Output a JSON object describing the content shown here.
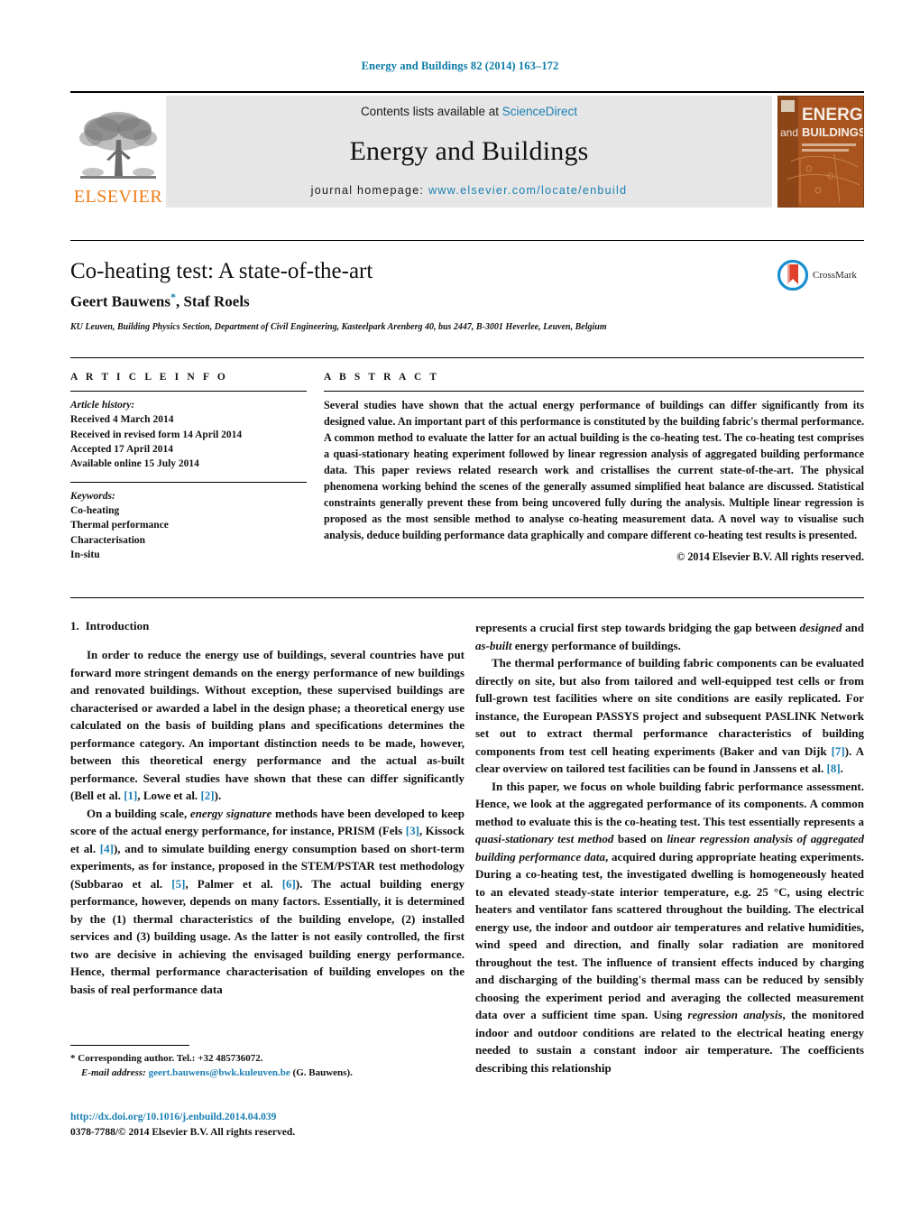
{
  "running_head": "Energy and Buildings 82 (2014) 163–172",
  "masthead": {
    "publisher_name": "ELSEVIER",
    "contents_prefix": "Contents lists available at ",
    "contents_link": "ScienceDirect",
    "journal_title": "Energy and Buildings",
    "homepage_prefix": "journal homepage: ",
    "homepage_url": "www.elsevier.com/locate/enbuild",
    "cover_title_line1": "ENERGY",
    "cover_title_and": "and",
    "cover_title_line2": "BUILDINGS"
  },
  "article": {
    "title": "Co-heating test: A state-of-the-art",
    "authors": "Geert Bauwens",
    "corresponding_marker": "*",
    "authors_rest": ", Staf Roels",
    "affiliation": "KU Leuven, Building Physics Section, Department of Civil Engineering, Kasteelpark Arenberg 40, bus 2447, B-3001 Heverlee, Leuven, Belgium",
    "crossmark_label": "CrossMark"
  },
  "info": {
    "heading": "A R T I C L E    I N F O",
    "history_label": "Article history:",
    "history": [
      "Received 4 March 2014",
      "Received in revised form 14 April 2014",
      "Accepted 17 April 2014",
      "Available online 15 July 2014"
    ],
    "keywords_label": "Keywords:",
    "keywords": [
      "Co-heating",
      "Thermal performance",
      "Characterisation",
      "In-situ"
    ]
  },
  "abstract": {
    "heading": "A B S T R A C T",
    "text": "Several studies have shown that the actual energy performance of buildings can differ significantly from its designed value. An important part of this performance is constituted by the building fabric's thermal performance. A common method to evaluate the latter for an actual building is the co-heating test. The co-heating test comprises a quasi-stationary heating experiment followed by linear regression analysis of aggregated building performance data. This paper reviews related research work and cristallises the current state-of-the-art. The physical phenomena working behind the scenes of the generally assumed simplified heat balance are discussed. Statistical constraints generally prevent these from being uncovered fully during the analysis. Multiple linear regression is proposed as the most sensible method to analyse co-heating measurement data. A novel way to visualise such analysis, deduce building performance data graphically and compare different co-heating test results is presented.",
    "copyright": "© 2014 Elsevier B.V. All rights reserved."
  },
  "introduction": {
    "number": "1.",
    "heading": "Introduction",
    "left_paragraphs": [
      {
        "parts": [
          {
            "t": "In order to reduce the energy use of buildings, several countries have put forward more stringent demands on the energy performance of new buildings and renovated buildings. Without exception, these supervised buildings are characterised or awarded a label in the design phase; a theoretical energy use calculated on the basis of building plans and specifications determines the performance category. An important distinction needs to be made, however, between this theoretical energy performance and the actual as-built performance. Several studies have shown that these can differ significantly (Bell et al. "
          },
          {
            "t": "[1]",
            "s": "cite"
          },
          {
            "t": ", Lowe et al. "
          },
          {
            "t": "[2]",
            "s": "cite"
          },
          {
            "t": ")."
          }
        ]
      },
      {
        "parts": [
          {
            "t": "On a building scale, "
          },
          {
            "t": "energy signature",
            "s": "it"
          },
          {
            "t": " methods have been developed to keep score of the actual energy performance, for instance, PRISM (Fels "
          },
          {
            "t": "[3]",
            "s": "cite"
          },
          {
            "t": ", Kissock et al. "
          },
          {
            "t": "[4]",
            "s": "cite"
          },
          {
            "t": "), and to simulate building energy consumption based on short-term experiments, as for instance, proposed in the STEM/PSTAR test methodology (Subbarao et al. "
          },
          {
            "t": "[5]",
            "s": "cite"
          },
          {
            "t": ", Palmer et al. "
          },
          {
            "t": "[6]",
            "s": "cite"
          },
          {
            "t": "). The actual building energy performance, however, depends on many factors. Essentially, it is determined by the (1) thermal characteristics of the building envelope, (2) installed services and (3) building usage. As the latter is not easily controlled, the first two are decisive in achieving the envisaged building energy performance. Hence, thermal performance characterisation of building envelopes on the basis of real performance data"
          }
        ]
      }
    ],
    "right_paragraphs": [
      {
        "continued": true,
        "parts": [
          {
            "t": "represents a crucial first step towards bridging the gap between "
          },
          {
            "t": "designed",
            "s": "it"
          },
          {
            "t": " and "
          },
          {
            "t": "as-built",
            "s": "it"
          },
          {
            "t": " energy performance of buildings."
          }
        ]
      },
      {
        "parts": [
          {
            "t": "The thermal performance of building fabric components can be evaluated directly on site, but also from tailored and well-equipped test cells or from full-grown test facilities where on site conditions are easily replicated. For instance, the European PASSYS project and subsequent PASLINK Network set out to extract thermal performance characteristics of building components from test cell heating experiments (Baker and van Dijk "
          },
          {
            "t": "[7]",
            "s": "cite"
          },
          {
            "t": "). A clear overview on tailored test facilities can be found in Janssens et al. "
          },
          {
            "t": "[8]",
            "s": "cite"
          },
          {
            "t": "."
          }
        ]
      },
      {
        "parts": [
          {
            "t": "In this paper, we focus on whole building fabric performance assessment. Hence, we look at the aggregated performance of its components. A common method to evaluate this is the co-heating test. This test essentially represents a "
          },
          {
            "t": "quasi-stationary test method",
            "s": "it"
          },
          {
            "t": " based on "
          },
          {
            "t": "linear regression analysis of aggregated building performance data",
            "s": "it"
          },
          {
            "t": ", acquired during appropriate heating experiments. During a co-heating test, the investigated dwelling is homogeneously heated to an elevated steady-state interior temperature, e.g. 25 °C, using electric heaters and ventilator fans scattered throughout the building. The electrical energy use, the indoor and outdoor air temperatures and relative humidities, wind speed and direction, and finally solar radiation are monitored throughout the test. The influence of transient effects induced by charging and discharging of the building's thermal mass can be reduced by sensibly choosing the experiment period and averaging the collected measurement data over a sufficient time span. Using "
          },
          {
            "t": "regression analysis",
            "s": "it"
          },
          {
            "t": ", the monitored indoor and outdoor conditions are related to the electrical heating energy needed to sustain a constant indoor air temperature. The coefficients describing this relationship"
          }
        ]
      }
    ]
  },
  "footer": {
    "corresponding_marker": "*",
    "corresponding_text": "Corresponding author. Tel.: +32 485736072.",
    "email_label": "E-mail address:",
    "email": "geert.bauwens@bwk.kuleuven.be",
    "email_suffix": "(G. Bauwens).",
    "doi": "http://dx.doi.org/10.1016/j.enbuild.2014.04.039",
    "issn_line": "0378-7788/© 2014 Elsevier B.V. All rights reserved."
  },
  "colors": {
    "link": "#1a7fb3",
    "elsevier_orange": "#ef7c16",
    "banner_gray": "#e6e6e6",
    "cover_orange": "#a9541f"
  }
}
